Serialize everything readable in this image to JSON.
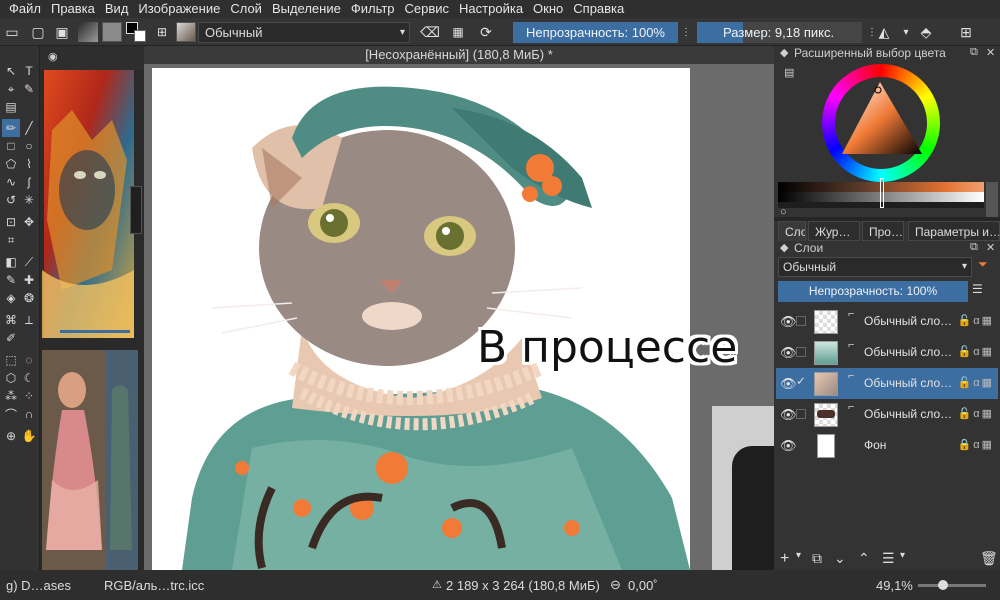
{
  "menu": [
    "Файл",
    "Правка",
    "Вид",
    "Изображение",
    "Слой",
    "Выделение",
    "Фильтр",
    "Сервис",
    "Настройка",
    "Окно",
    "Справка"
  ],
  "toolbar": {
    "blend_mode": "Обычный",
    "opacity": "Непрозрачность: 100%",
    "size": "Размер: 9,18 пикс."
  },
  "document": {
    "title": "[Несохранённый]  (180,8 МиБ) *",
    "overlay_caption": "В процессе"
  },
  "color_docker": {
    "title": "Расширенный выбор цвета"
  },
  "docker_tabs": [
    "Сло…",
    "Жур…",
    "Про…",
    "Параметры и…"
  ],
  "layers_docker": {
    "title": "Слои",
    "blend_mode": "Обычный",
    "opacity": "Непрозрачность: 100%",
    "layers": [
      {
        "name": "Обычный сло…",
        "selected": false,
        "checked": false
      },
      {
        "name": "Обычный сло…",
        "selected": false,
        "checked": false
      },
      {
        "name": "Обычный сло…",
        "selected": true,
        "checked": true
      },
      {
        "name": "Обычный сло…",
        "selected": false,
        "checked": false
      },
      {
        "name": "Фон",
        "selected": false,
        "checked": false
      }
    ]
  },
  "status": {
    "brush": "g) D…ases",
    "colorspace": "RGB/аль…trc.icc",
    "dimensions": "2 189 x 3 264 (180,8 МиБ)",
    "rotation": "0,00˚",
    "zoom": "49,1%"
  },
  "colors": {
    "accent": "#3d6ea1",
    "paint_teal": "#5f9e93",
    "paint_orange": "#f07a36"
  }
}
